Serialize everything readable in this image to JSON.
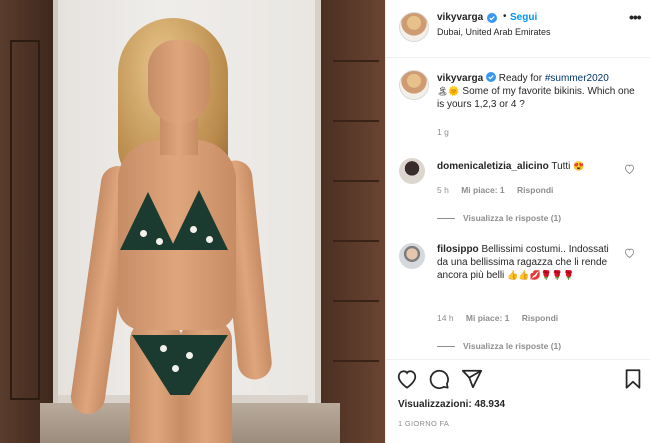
{
  "post": {
    "username": "vikyvarga",
    "follow_label": "Segui",
    "separator": "•",
    "location": "Dubai, United Arab Emirates",
    "more_label": "•••"
  },
  "caption": {
    "username": "vikyvarga",
    "lead": "Ready for",
    "hashtag": "#summer2020",
    "emoji": "🏝🌞",
    "text": "Some of my favorite bikinis. Which one is yours 1,2,3 or 4 ?",
    "time": "1 g"
  },
  "comments": [
    {
      "username": "domenicaletizia_alicino",
      "text": "Tutti",
      "emoji": "😍",
      "time": "5 h",
      "likes": "Mi piace: 1",
      "reply_label": "Rispondi",
      "view_replies": "Visualizza le risposte (1)"
    },
    {
      "username": "filosippo",
      "text": "Bellissimi costumi.. Indossati da una bellissima ragazza che li rende ancora più belli",
      "emoji": "👍👍💋🌹🌹🌹",
      "time": "14 h",
      "likes": "Mi piace: 1",
      "reply_label": "Rispondi",
      "view_replies": "Visualizza le risposte (1)"
    }
  ],
  "stats": {
    "views_label": "Visualizzazioni:",
    "views_value": "48.934",
    "posted": "1 GIORNO FA"
  },
  "colors": {
    "link": "#0095f6",
    "hashtag": "#00376b",
    "muted": "#8e8e8e",
    "bikini": "#1b3a30"
  },
  "icons": [
    "heart-icon",
    "comment-icon",
    "share-icon",
    "bookmark-icon",
    "verified-icon",
    "more-icon"
  ]
}
